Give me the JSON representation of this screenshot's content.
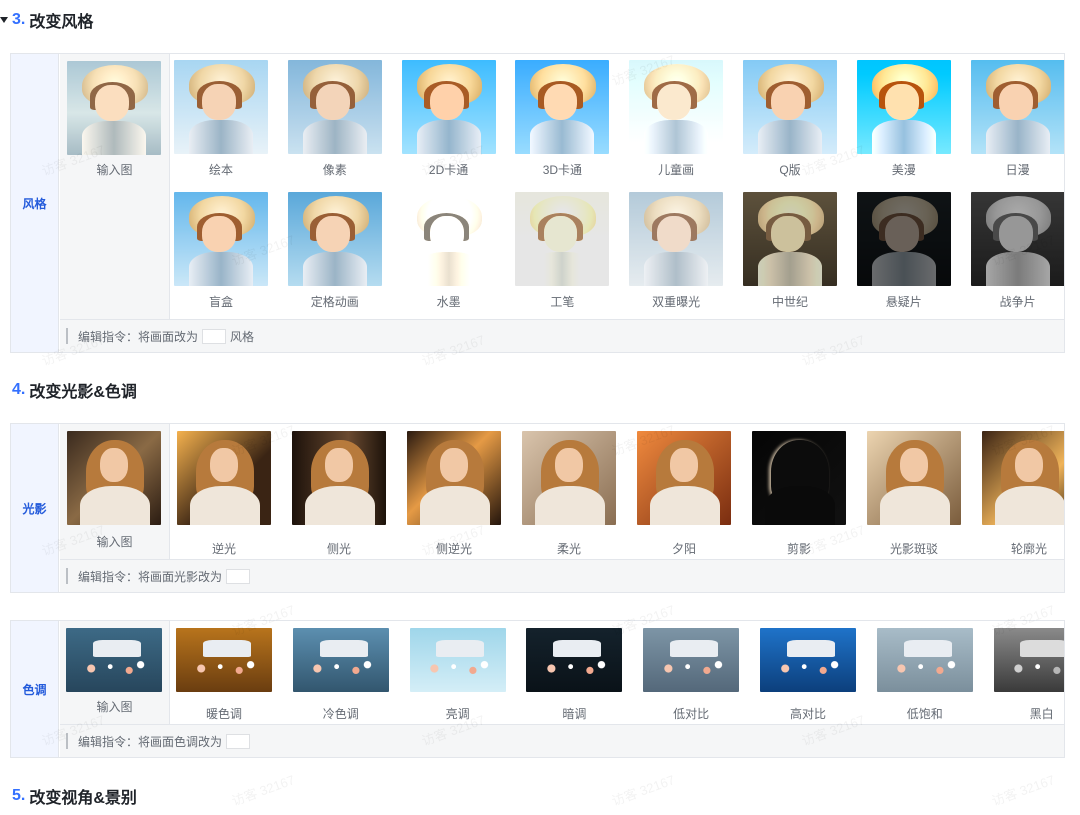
{
  "sections": {
    "style": {
      "num": "3.",
      "title": "改变风格"
    },
    "light_tone": {
      "num": "4.",
      "title": "改变光影&色调"
    },
    "view": {
      "num": "5.",
      "title": "改变视角&景别"
    }
  },
  "style_panel": {
    "side_label": "风格",
    "input_label": "输入图",
    "items": [
      "绘本",
      "像素",
      "2D卡通",
      "3D卡通",
      "儿童画",
      "Q版",
      "美漫",
      "日漫",
      "盲盒",
      "定格动画",
      "水墨",
      "工笔",
      "双重曝光",
      "中世纪",
      "悬疑片",
      "战争片"
    ],
    "instruction_prefix": "编辑指令：将画面改为",
    "instruction_suffix": "风格"
  },
  "light_panel": {
    "side_label": "光影",
    "input_label": "输入图",
    "items": [
      "逆光",
      "侧光",
      "侧逆光",
      "柔光",
      "夕阳",
      "剪影",
      "光影斑驳",
      "轮廓光"
    ],
    "instruction_prefix": "编辑指令：将画面光影改为"
  },
  "tone_panel": {
    "side_label": "色调",
    "input_label": "输入图",
    "items": [
      "暖色调",
      "冷色调",
      "亮调",
      "暗调",
      "低对比",
      "高对比",
      "低饱和",
      "黑白"
    ],
    "instruction_prefix": "编辑指令：将画面色调改为"
  },
  "watermark": "访客 32167",
  "colors": {
    "accent": "#3370ff",
    "side_label": "#245bdb",
    "side_bg": "#f1f5ff"
  }
}
